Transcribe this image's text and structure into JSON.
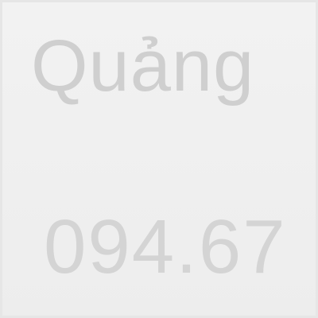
{
  "banner": {
    "headline": "Quảng",
    "phone": "094.67"
  }
}
